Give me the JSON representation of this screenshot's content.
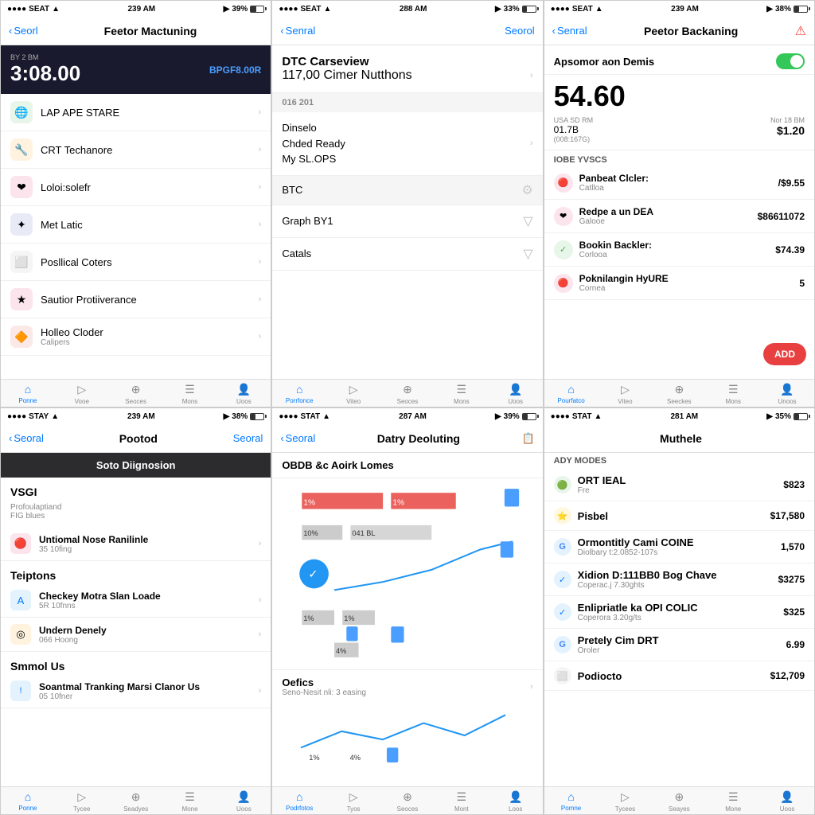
{
  "panels": [
    {
      "id": "panel1",
      "statusBar": {
        "carrier": "SEAT",
        "time": "239 AM",
        "signal": "39%",
        "battery": 39
      },
      "navBar": {
        "back": "Seorl",
        "title": "Feetor Mactuning",
        "right": ""
      },
      "timeBlock": {
        "label": "BY 2 BM",
        "value": "3:08.00",
        "sub": "BPGF8.00R"
      },
      "appItems": [
        {
          "label": "LAP APE STARE",
          "color": "#4caf50",
          "icon": "🌐"
        },
        {
          "label": "CRT Techanore",
          "color": "#ff9800",
          "icon": "🔧"
        },
        {
          "label": "Loloi:solefr",
          "color": "#f44336",
          "icon": "❤"
        },
        {
          "label": "Met Latic",
          "color": "#3f51b5",
          "icon": "✦"
        },
        {
          "label": "Posllical Coters",
          "color": "#9e9e9e",
          "icon": "⬜"
        },
        {
          "label": "Sautior Protiiverance",
          "color": "#e91e63",
          "icon": "★"
        },
        {
          "label": "Holleo Cloder",
          "color": "#ff5722",
          "icon": "🔶",
          "sub": "Calipers"
        }
      ],
      "tabs": [
        "Ponne",
        "Vooe",
        "Seoces",
        "Mons",
        "Uoos"
      ]
    },
    {
      "id": "panel2",
      "statusBar": {
        "carrier": "SEAT",
        "time": "288 AM",
        "signal": "33%",
        "battery": 33
      },
      "navBar": {
        "back": "Senral",
        "title": "",
        "right": "Seorol"
      },
      "sections": [
        {
          "header": "DTC Carseview",
          "sub": "117,00 Cimer Nutthons",
          "rows": []
        },
        {
          "header": "016 201",
          "rows": [
            {
              "label": "Dinselo\nChded Ready\nMy SL.OPS",
              "right": ""
            }
          ]
        },
        {
          "header": "BTC",
          "rows": [],
          "disabled": true
        },
        {
          "header": "Graph BY1",
          "rows": [],
          "collapsed": true
        },
        {
          "header": "Catals",
          "rows": [],
          "collapsed": true
        }
      ],
      "tabs": [
        "Porrfonce",
        "Viteo",
        "Seoces",
        "Mons",
        "Uoos"
      ]
    },
    {
      "id": "panel3",
      "statusBar": {
        "carrier": "SEAT",
        "time": "239 AM",
        "signal": "38%",
        "battery": 38
      },
      "navBar": {
        "back": "Senral",
        "title": "Peetor Backaning",
        "right": "alert"
      },
      "account": {
        "toggleLabel": "Apsomor aon Demis",
        "amount": "54.60",
        "exchangeLeft": "USA SD RM",
        "exchangeLeftVal": "01.7B",
        "exchangeRightLabel": "Nor 18 BM",
        "exchangeRightVal": "$1.20",
        "sectionLabel": "IOBE YVSCS",
        "items": [
          {
            "name": "Panbeat Clcler:",
            "sub": "Catlloa",
            "amount": "/$9.55",
            "color": "#f44336",
            "icon": "🔴"
          },
          {
            "name": "Redpe a un DEA",
            "sub": "Galooe",
            "amount": "$86611072",
            "color": "#e91e63",
            "icon": "❤"
          },
          {
            "name": "Bookin Backler:",
            "sub": "Corlooa",
            "amount": "$74.39",
            "color": "#4caf50",
            "icon": "✓"
          },
          {
            "name": "Poknilangin HyURE",
            "sub": "Cornea",
            "amount": "5",
            "color": "#f44336",
            "icon": "🔴"
          }
        ],
        "addButton": "ADD"
      },
      "tabs": [
        "Pourfatco",
        "Viteo",
        "Seeckes",
        "Mons",
        "Unoos"
      ]
    },
    {
      "id": "panel4",
      "statusBar": {
        "carrier": "STAY",
        "time": "239 AM",
        "signal": "38%",
        "battery": 38
      },
      "navBar": {
        "back": "Seoral",
        "title": "Pootod",
        "right": "Seoral"
      },
      "darkHeader": "Soto Diignosion",
      "groups": [
        {
          "label": "VSGI",
          "sub": "Profoulaptiand\nFIG blues",
          "rows": [
            {
              "title": "Untiomal Nose Ranilinle",
              "sub": "35 10fing",
              "icon": "🔴",
              "iconBg": "#f44336"
            }
          ]
        },
        {
          "label": "Teiptons",
          "rows": [
            {
              "title": "Checkey Motra Slan Loade",
              "sub": "5R 10fnns",
              "icon": "A",
              "iconBg": "#007aff"
            },
            {
              "title": "Undern Denely",
              "sub": "066 Hoong",
              "icon": "◎",
              "iconBg": "#ff9800"
            }
          ]
        },
        {
          "label": "Smmol Us",
          "rows": [
            {
              "title": "Soantmal Tranking Marsi Clanor Us",
              "sub": "05 10fner",
              "icon": "!",
              "iconBg": "#007aff"
            }
          ]
        }
      ],
      "tabs": [
        "Ponne",
        "Tycee",
        "Seadyes",
        "Mone",
        "Uoos"
      ]
    },
    {
      "id": "panel5",
      "statusBar": {
        "carrier": "STAT",
        "time": "287 AM",
        "signal": "39%",
        "battery": 39
      },
      "navBar": {
        "back": "Seoral",
        "title": "Datry Deoluting",
        "right": "📋"
      },
      "chartHeader": "OBDB &c Aoirk Lomes",
      "chartBars": [
        {
          "label": "1%",
          "value": 60
        },
        {
          "label": "1%",
          "value": 60
        },
        {
          "label": "10%",
          "value": 30
        },
        {
          "label": "041 BL",
          "value": 50
        },
        {
          "label": "1%",
          "value": 25
        },
        {
          "label": "1%",
          "value": 25
        },
        {
          "label": "4%",
          "value": 20
        }
      ],
      "oefics": {
        "title": "Oefics",
        "sub": "Seno-Nesit nli: 3 easing"
      },
      "tabs": [
        "Podrfotos",
        "Tyos",
        "Seoces",
        "Mont",
        "Loos"
      ]
    },
    {
      "id": "panel6",
      "statusBar": {
        "carrier": "STAT",
        "time": "281 AM",
        "signal": "35%",
        "battery": 35
      },
      "navBar": {
        "back": "",
        "title": "Muthele",
        "right": ""
      },
      "modesLabel": "ADY MODES",
      "modes": [
        {
          "name": "ORT IEAL",
          "sub": "Fre",
          "amount": "$823",
          "color": "#4caf50",
          "icon": "🟢"
        },
        {
          "name": "Pisbel",
          "sub": "",
          "amount": "$17,580",
          "color": "#f5a623",
          "icon": "⭐"
        },
        {
          "name": "Ormontitly Cami COINE",
          "sub": "Diolbary t:2.0852-107s",
          "amount": "1,570",
          "color": "#4285f4",
          "icon": "G"
        },
        {
          "name": "Xidion D:111BB0 Bog Chave",
          "sub": "Coperac.j 7.30ghts",
          "amount": "$3275",
          "color": "#007aff",
          "icon": "✓"
        },
        {
          "name": "Enlipriatle ka OPI COLIC",
          "sub": "Coperora 3.20g/ts",
          "amount": "$325",
          "color": "#007aff",
          "icon": "✓"
        },
        {
          "name": "Pretely Cim DRT",
          "sub": "Oroler",
          "amount": "6.99",
          "color": "#4285f4",
          "icon": "G"
        },
        {
          "name": "Podiocto",
          "sub": "",
          "amount": "$12,709",
          "color": "#9e9e9e",
          "icon": "⬜"
        }
      ],
      "tabs": [
        "Pomne",
        "Tycees",
        "Seayes",
        "Mone",
        "Uoos"
      ]
    }
  ]
}
